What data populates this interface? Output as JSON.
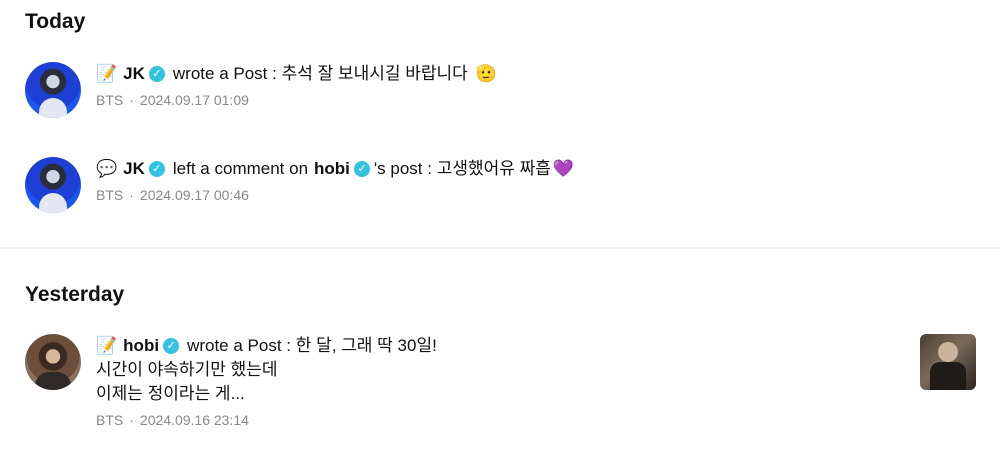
{
  "sections": {
    "today": "Today",
    "yesterday": "Yesterday"
  },
  "notifications": [
    {
      "icon": "memo-emoji",
      "emoji": "📝",
      "author": "JK",
      "action": "wrote a Post : 추석 잘 보내시길 바랍니다",
      "trailing_emoji": "🫡",
      "source": "BTS",
      "time": "2024.09.17 01:09"
    },
    {
      "icon": "speech-bubble-emoji",
      "emoji": "💬",
      "author": "JK",
      "action": "left a comment on",
      "target_author": "hobi",
      "action_suffix": "'s post : 고생했어유 짜흡",
      "trailing_emoji": "💜",
      "source": "BTS",
      "time": "2024.09.17 00:46"
    },
    {
      "icon": "memo-emoji",
      "emoji": "📝",
      "author": "hobi",
      "action": "wrote a Post : 한 달, 그래 딱 30일!",
      "continuation": [
        "시간이 야속하기만 했는데",
        "이제는 정이라는 게..."
      ],
      "source": "BTS",
      "time": "2024.09.16 23:14"
    }
  ],
  "meta_separator": "·",
  "verified_mark": "✓",
  "colors": {
    "verified": "#33c2e0",
    "meta": "#888888"
  }
}
